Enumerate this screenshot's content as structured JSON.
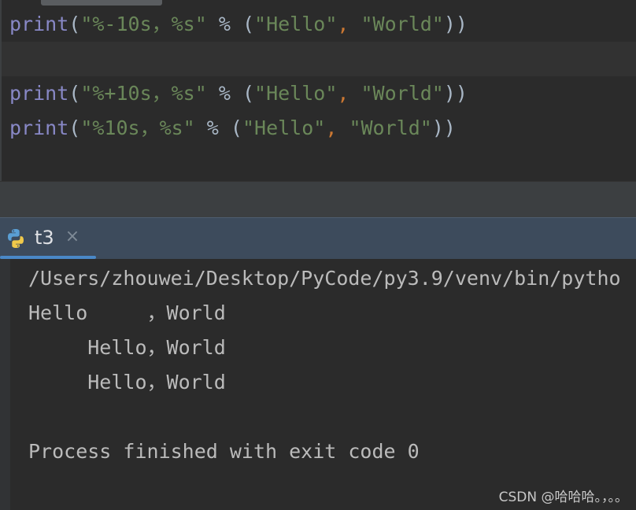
{
  "editor": {
    "lines": [
      {
        "fn": "print",
        "open": "(",
        "fmt": "\"%-10s，%s\"",
        "op": " % (",
        "arg1": "\"Hello\"",
        "comma": ",",
        "space": " ",
        "arg2": "\"World\"",
        "close": "))"
      },
      {
        "fn": "print",
        "open": "(",
        "fmt": "\"%+10s，%s\"",
        "op": " % (",
        "arg1": "\"Hello\"",
        "comma": ",",
        "space": " ",
        "arg2": "\"World\"",
        "close": "))"
      },
      {
        "fn": "print",
        "open": "(",
        "fmt": "\"%10s，%s\"",
        "op": " % (",
        "arg1": "\"Hello\"",
        "comma": ",",
        "space": " ",
        "arg2": "\"World\"",
        "close": "))"
      }
    ]
  },
  "run_panel": {
    "tab_label": "t3",
    "tab_icon": "python-icon",
    "close_icon": "close-icon"
  },
  "console": {
    "lines": [
      "/Users/zhouwei/Desktop/PyCode/py3.9/venv/bin/pytho",
      "Hello     ，World",
      "     Hello，World",
      "     Hello，World",
      "Process finished with exit code 0"
    ]
  },
  "watermark": "CSDN @哈哈哈。，。。",
  "colors": {
    "editor_bg": "#2b2b2b",
    "builtin": "#8888c6",
    "string": "#6a8759",
    "comma": "#cc7832",
    "tab_header": "#3d4b5c",
    "tab_underline": "#4a88c7"
  }
}
